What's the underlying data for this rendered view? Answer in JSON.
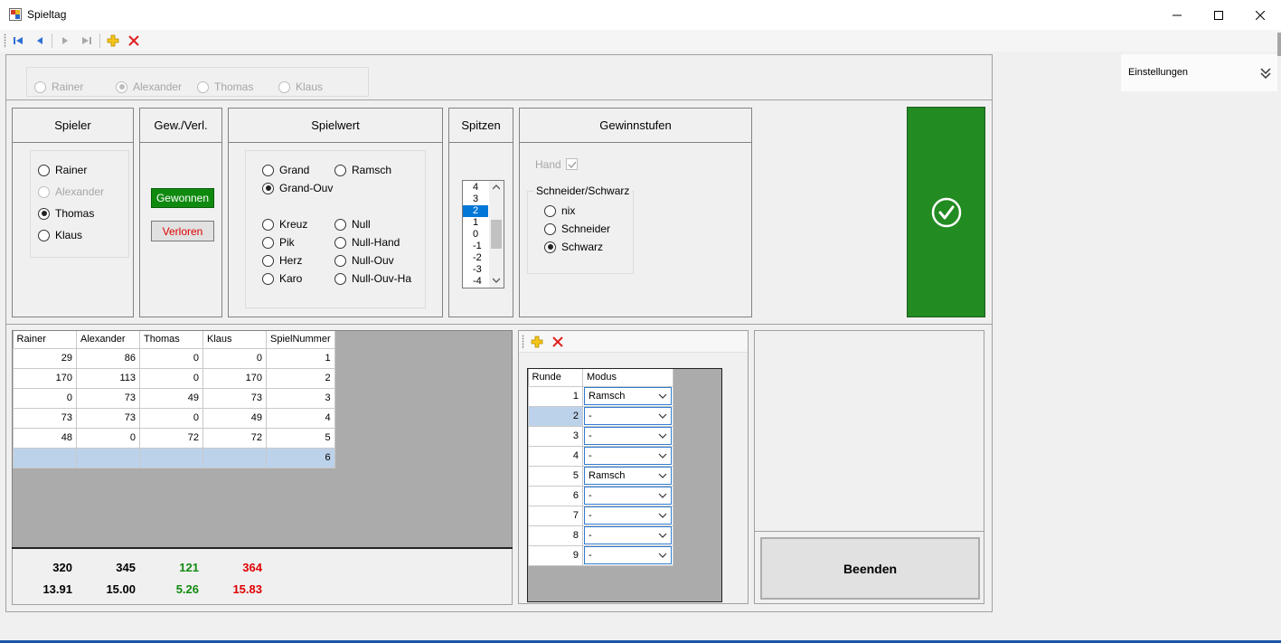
{
  "window": {
    "title": "Spieltag"
  },
  "players": [
    "Rainer",
    "Alexander",
    "Thomas",
    "Klaus"
  ],
  "top_selector": {
    "selected": "Alexander"
  },
  "sections": {
    "spieler": {
      "title": "Spieler",
      "selected": "Thomas",
      "disabled": "Alexander"
    },
    "gewverl": {
      "title": "Gew./Verl.",
      "won_label": "Gewonnen",
      "lost_label": "Verloren"
    },
    "spielwert": {
      "title": "Spielwert",
      "options": [
        "Grand",
        "Ramsch",
        "Grand-Ouv",
        "Kreuz",
        "Null",
        "Pik",
        "Null-Hand",
        "Herz",
        "Null-Ouv",
        "Karo",
        "Null-Ouv-Ha"
      ],
      "selected": "Grand-Ouv"
    },
    "spitzen": {
      "title": "Spitzen",
      "items": [
        "4",
        "3",
        "2",
        "1",
        "0",
        "-1",
        "-2",
        "-3",
        "-4"
      ],
      "selected": "2"
    },
    "gewinnstufen": {
      "title": "Gewinnstufen",
      "hand_label": "Hand",
      "schneider_group": "Schneider/Schwarz",
      "options": [
        "nix",
        "Schneider",
        "Schwarz"
      ],
      "selected": "Schwarz"
    }
  },
  "settings_panel": {
    "label": "Einstellungen"
  },
  "score_table": {
    "columns": [
      "Rainer",
      "Alexander",
      "Thomas",
      "Klaus",
      "SpielNummer"
    ],
    "rows": [
      [
        "29",
        "86",
        "0",
        "0",
        "1"
      ],
      [
        "170",
        "113",
        "0",
        "170",
        "2"
      ],
      [
        "0",
        "73",
        "49",
        "73",
        "3"
      ],
      [
        "73",
        "73",
        "0",
        "49",
        "4"
      ],
      [
        "48",
        "0",
        "72",
        "72",
        "5"
      ],
      [
        "",
        "",
        "",
        "",
        "6"
      ]
    ]
  },
  "totals": {
    "sums": [
      "320",
      "345",
      "121",
      "364"
    ],
    "averages": [
      "13.91",
      "15.00",
      "5.26",
      "15.83"
    ],
    "colors": [
      "#000000",
      "#000000",
      "#118a11",
      "#e00000"
    ]
  },
  "round_table": {
    "columns": [
      "Runde",
      "Modus"
    ],
    "rows": [
      [
        "1",
        "Ramsch"
      ],
      [
        "2",
        "-"
      ],
      [
        "3",
        "-"
      ],
      [
        "4",
        "-"
      ],
      [
        "5",
        "Ramsch"
      ],
      [
        "6",
        "-"
      ],
      [
        "7",
        "-"
      ],
      [
        "8",
        "-"
      ],
      [
        "9",
        "-"
      ]
    ]
  },
  "buttons": {
    "exit_label": "Beenden"
  },
  "colors": {
    "confirm_green": "#228b22",
    "won_green": "#0f8a0f",
    "lost_red": "#e00000",
    "selection": "#0078d7"
  }
}
